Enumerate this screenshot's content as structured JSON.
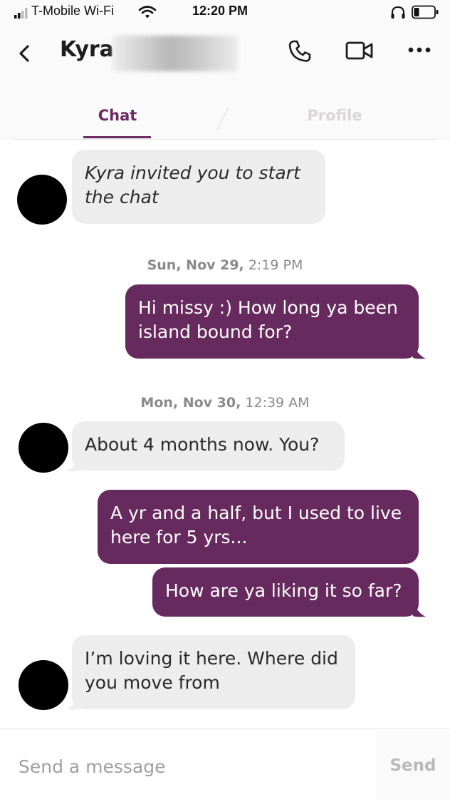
{
  "status_bar": {
    "carrier": "T-Mobile Wi-Fi",
    "time": "12:20 PM"
  },
  "header": {
    "contact_name": "Kyra",
    "tabs": [
      {
        "label": "Chat",
        "active": true
      },
      {
        "label": "Profile",
        "active": false
      }
    ]
  },
  "conversation": {
    "system_message": "Kyra invited you to start the chat",
    "groups": [
      {
        "date_bold": "Sun, Nov 29,",
        "time": "2:19 PM",
        "messages": [
          {
            "from": "me",
            "text": "Hi missy :) How long ya been island bound for?"
          }
        ]
      },
      {
        "date_bold": "Mon, Nov 30,",
        "time": "12:39 AM",
        "messages": [
          {
            "from": "them",
            "text": "About 4 months now. You?"
          },
          {
            "from": "me",
            "text": "A yr and a half, but I used to live here for 5 yrs..."
          },
          {
            "from": "me",
            "text": "How are ya liking it so far?"
          },
          {
            "from": "them",
            "text": "I’m loving it here. Where did you move from"
          }
        ]
      }
    ]
  },
  "composer": {
    "placeholder": "Send a message",
    "send_label": "Send"
  },
  "colors": {
    "brand_purple": "#672a5f",
    "incoming_bubble": "#eeeded"
  }
}
